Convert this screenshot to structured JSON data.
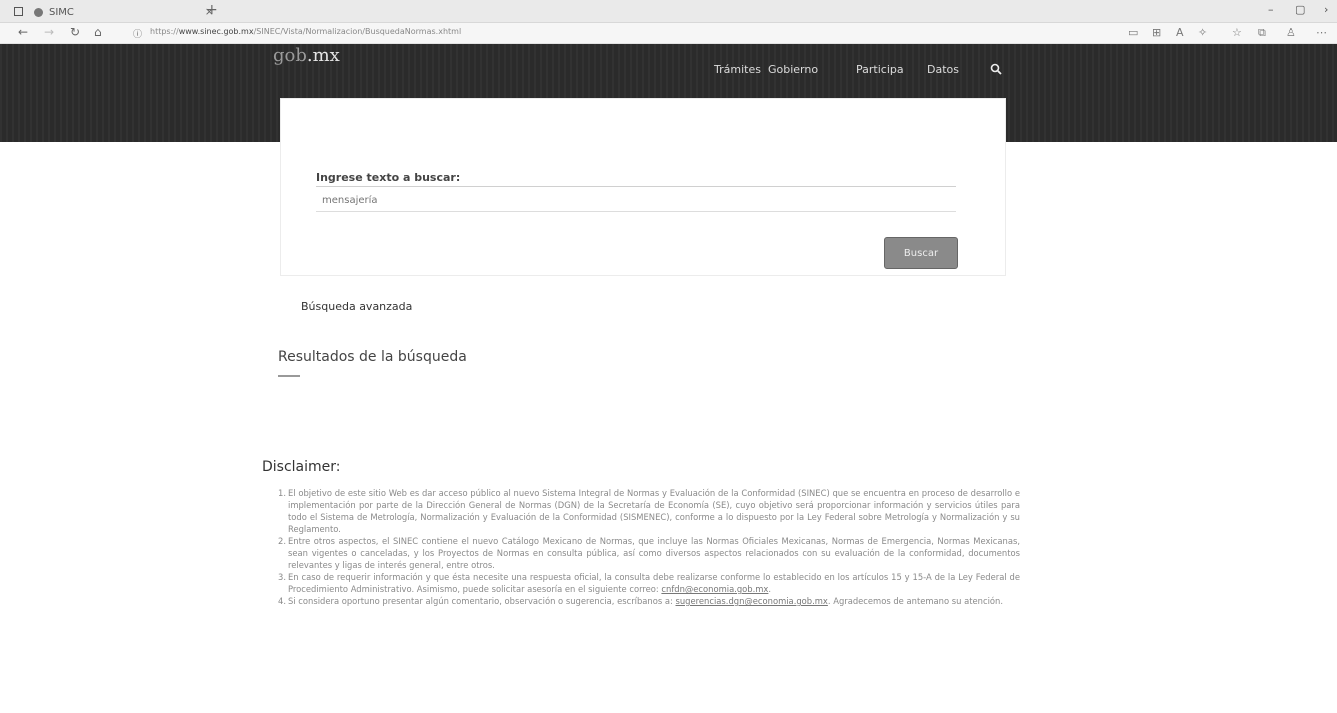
{
  "browser": {
    "tab_title": "SIMC",
    "tab_close": "×",
    "new_tab": "+",
    "url_prefix": "https://",
    "url_host": "www.sinec.gob.mx",
    "url_path": "/SINEC/Vista/Normalizacion/BusquedaNormas.xhtml",
    "win_min": "–",
    "win_max": "▢",
    "win_close": "›"
  },
  "header": {
    "logo_gob": "gob",
    "logo_mx": ".mx",
    "menu": [
      "Trámites",
      "Gobierno",
      "Participa",
      "Datos"
    ]
  },
  "search": {
    "label": "Ingrese texto a buscar:",
    "placeholder": "mensajería",
    "button": "Buscar"
  },
  "advanced_link": "Búsqueda avanzada",
  "results_title": "Resultados de la búsqueda",
  "disclaimer": {
    "title": "Disclaimer:",
    "items": [
      {
        "n": "1.",
        "text": "El objetivo de este sitio Web es dar acceso público al nuevo Sistema Integral de Normas y Evaluación de la Conformidad (SINEC) que se encuentra en proceso de desarrollo e implementación por parte de la Dirección General de Normas (DGN) de la Secretaría de Economía (SE), cuyo objetivo será proporcionar información y servicios útiles para todo el Sistema de Metrología, Normalización y Evaluación de la Conformidad (SISMENEC), conforme a lo dispuesto por la Ley Federal sobre Metrología y Normalización y su Reglamento."
      },
      {
        "n": "2.",
        "text": "Entre otros aspectos, el SINEC contiene el nuevo Catálogo Mexicano de Normas, que incluye las Normas Oficiales Mexicanas, Normas de Emergencia, Normas Mexicanas, sean vigentes o canceladas, y los Proyectos de Normas en consulta pública, así como diversos aspectos relacionados con su evaluación de la conformidad, documentos relevantes y ligas de interés general, entre otros."
      },
      {
        "n": "3.",
        "text": "En caso de requerir información y que ésta necesite una respuesta oficial, la consulta debe realizarse conforme lo establecido en los artículos 15 y 15-A de la Ley Federal de Procedimiento Administrativo. Asimismo, puede solicitar asesoría en el siguiente correo: ",
        "link": "cnfdn@economia.gob.mx"
      },
      {
        "n": "4.",
        "text": "Si considera oportuno presentar algún comentario, observación o sugerencia, escríbanos a: ",
        "link": "sugerencias.dgn@economia.gob.mx",
        "after": ". Agradecemos de antemano su atención."
      }
    ]
  }
}
